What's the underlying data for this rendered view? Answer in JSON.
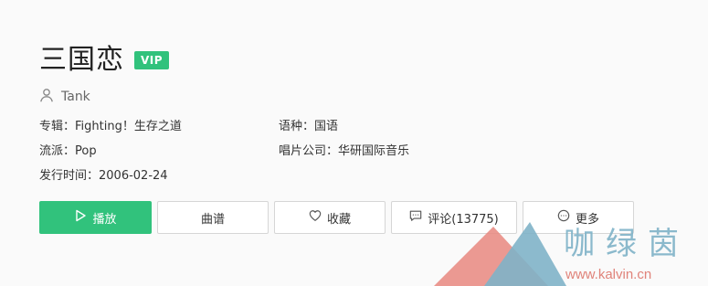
{
  "song": {
    "title": "三国恋",
    "badge": "VIP",
    "singer": "Tank"
  },
  "info": {
    "album_label": "专辑：",
    "album": "Fighting！生存之道",
    "language_label": "语种：",
    "language": "国语",
    "genre_label": "流派：",
    "genre": "Pop",
    "label_company_label": "唱片公司：",
    "label_company": "华研国际音乐",
    "release_label": "发行时间：",
    "release_date": "2006-02-24"
  },
  "buttons": {
    "play": "播放",
    "score": "曲谱",
    "favorite": "收藏",
    "comment": "评论(13775)",
    "more": "更多"
  },
  "watermark": {
    "text": "咖绿茵",
    "url": "www.kalvin.cn"
  },
  "colors": {
    "accent": "#31c27c",
    "text": "#333333",
    "muted": "#666666",
    "border": "#d6d6d6"
  },
  "icons": {
    "singer": "user-icon",
    "play": "play-icon",
    "favorite": "heart-icon",
    "comment": "comment-icon",
    "more": "more-icon"
  }
}
